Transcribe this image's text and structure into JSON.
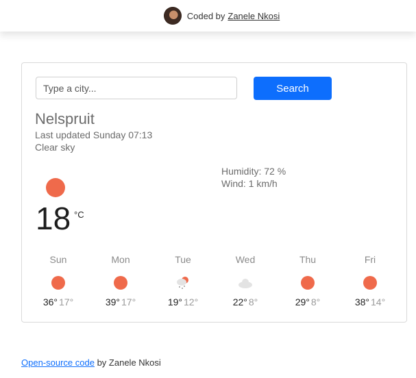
{
  "header": {
    "coded_by": "Coded by",
    "author": "Zanele Nkosi"
  },
  "search": {
    "placeholder": "Type a city...",
    "button_label": "Search"
  },
  "current": {
    "city": "Nelspruit",
    "last_updated": "Last updated Sunday 07:13",
    "description": "Clear sky",
    "temperature": "18",
    "unit": "°C",
    "humidity": "Humidity: 72 %",
    "wind": "Wind: 1 km/h",
    "icon": "sun-icon"
  },
  "forecast": [
    {
      "day": "Sun",
      "max": "36°",
      "min": "17°",
      "icon": "sun-icon"
    },
    {
      "day": "Mon",
      "max": "39°",
      "min": "17°",
      "icon": "sun-icon"
    },
    {
      "day": "Tue",
      "max": "19°",
      "min": "12°",
      "icon": "rain-sun-icon"
    },
    {
      "day": "Wed",
      "max": "22°",
      "min": "8°",
      "icon": "cloud-icon"
    },
    {
      "day": "Thu",
      "max": "29°",
      "min": "8°",
      "icon": "sun-icon"
    },
    {
      "day": "Fri",
      "max": "38°",
      "min": "14°",
      "icon": "sun-icon"
    }
  ],
  "footer": {
    "link_text": "Open-source code",
    "suffix": "by Zanele Nkosi"
  },
  "colors": {
    "accent": "#0d6efd",
    "sun": "#ef6a4b"
  }
}
